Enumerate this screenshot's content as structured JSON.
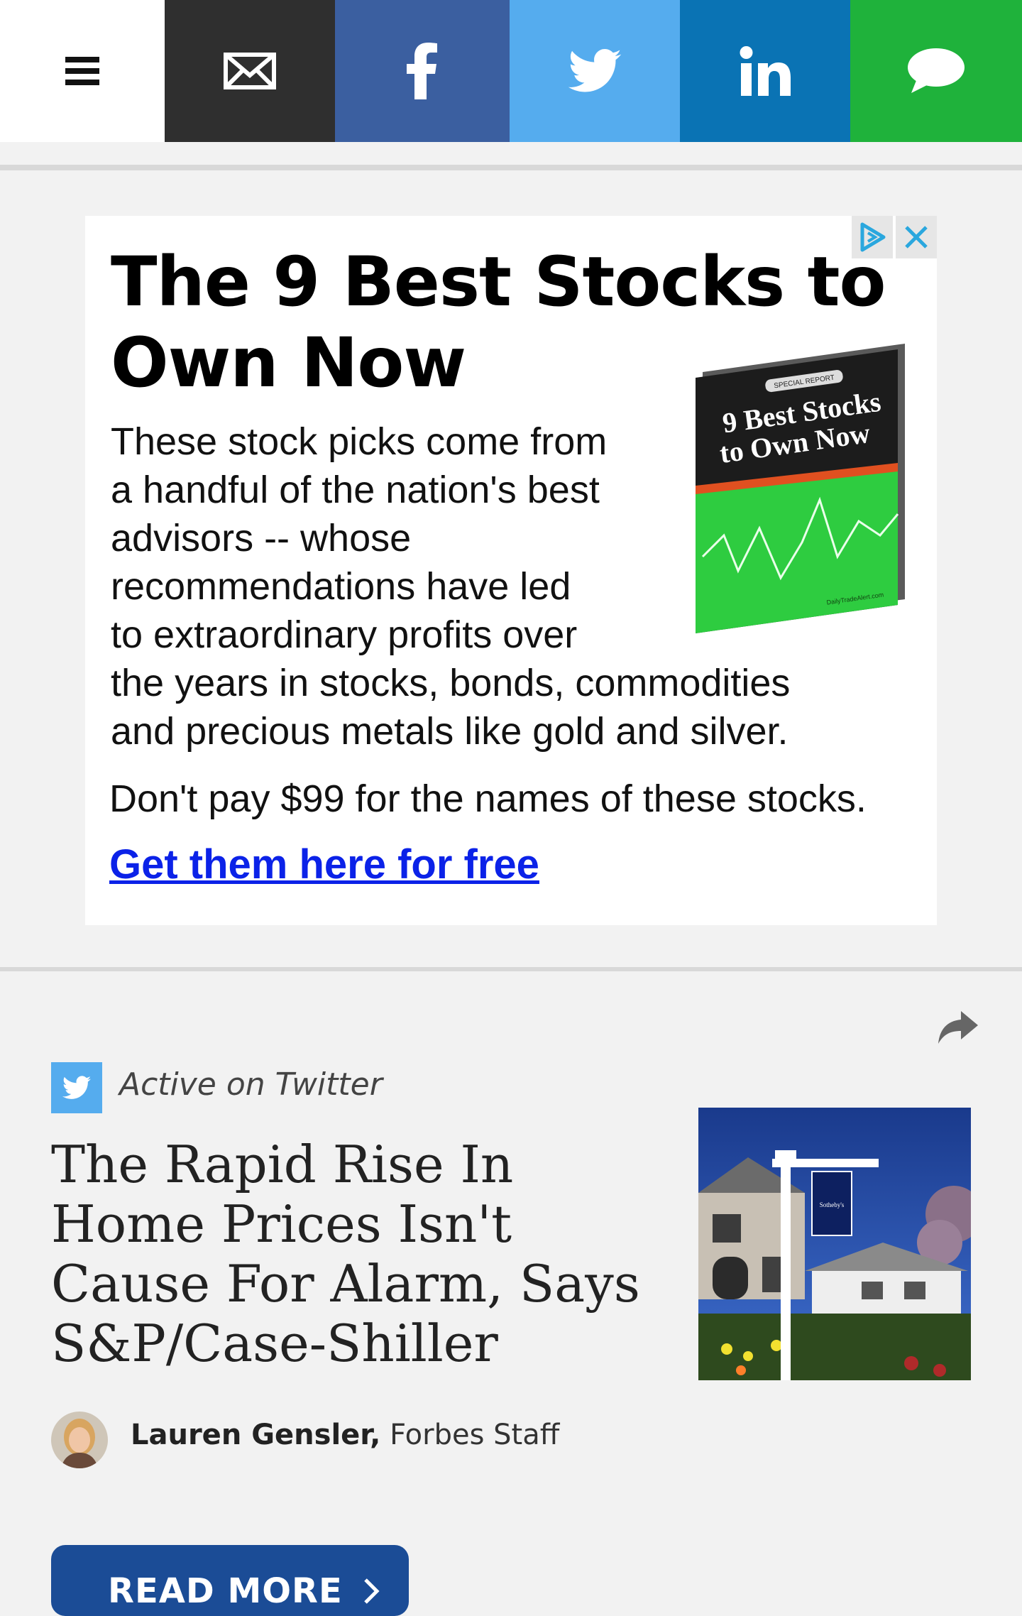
{
  "share_bar": {
    "items": [
      {
        "name": "menu",
        "icon": "hamburger-menu-icon"
      },
      {
        "name": "email",
        "icon": "envelope-icon",
        "color": "#2f2f2f"
      },
      {
        "name": "facebook",
        "icon": "facebook-icon",
        "color": "#3b5fa0"
      },
      {
        "name": "twitter",
        "icon": "twitter-bird-icon",
        "color": "#55acee"
      },
      {
        "name": "linkedin",
        "icon": "linkedin-icon",
        "color": "#0a73b4"
      },
      {
        "name": "comment",
        "icon": "speech-bubble-icon",
        "color": "#1fb23b"
      }
    ]
  },
  "ad": {
    "headline": "The 9 Best Stocks to Own Now",
    "body_lines": [
      "These stock picks come from",
      "a handful of the nation's best",
      "advisors -- whose",
      "recommendations have led",
      "to extraordinary profits over",
      "the years in stocks, bonds, commodities",
      "and precious metals like gold and silver."
    ],
    "cta_text": "Don't pay $99 for the names of these stocks.",
    "link": "Get them here for free",
    "book": {
      "badge": "SPECIAL REPORT",
      "title_line1": "9 Best Stocks",
      "title_line2": "to Own Now",
      "publisher": "DailyTradeAlert.com"
    },
    "choices_icon": "adchoices-icon",
    "close_icon": "close-icon"
  },
  "article": {
    "source_label": "Active on Twitter",
    "headline": "The Rapid Rise In Home Prices Isn't Cause For Alarm, Says S&P/Case-Shiller",
    "author_name": "Lauren Gensler,",
    "author_role": "Forbes Staff",
    "read_more": "READ MORE",
    "thumb_sign_text": "Sotheby's"
  }
}
